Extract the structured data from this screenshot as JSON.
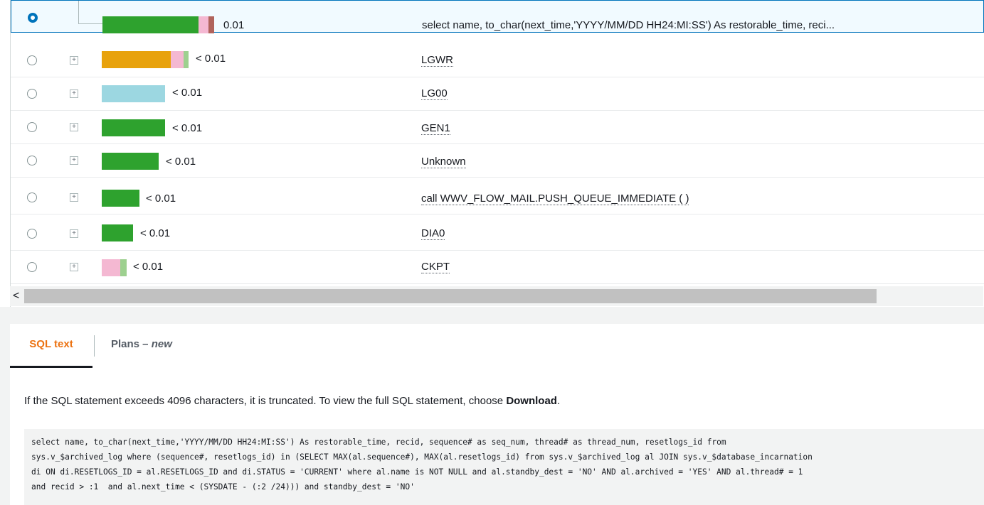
{
  "rows": [
    {
      "selected": true,
      "value": "0.01",
      "name": "select name, to_char(next_time,'YYYY/MM/DD HH24:MI:SS') As restorable_time, reci...",
      "expander": false
    },
    {
      "selected": false,
      "value": "< 0.01",
      "name": "LGWR",
      "expander": true
    },
    {
      "selected": false,
      "value": "< 0.01",
      "name": "LG00",
      "expander": true
    },
    {
      "selected": false,
      "value": "< 0.01",
      "name": "GEN1",
      "expander": true
    },
    {
      "selected": false,
      "value": "< 0.01",
      "name": "Unknown",
      "expander": true
    },
    {
      "selected": false,
      "value": "< 0.01",
      "name": "call WWV_FLOW_MAIL.PUSH_QUEUE_IMMEDIATE ( )",
      "expander": true
    },
    {
      "selected": false,
      "value": "< 0.01",
      "name": "DIA0",
      "expander": true
    },
    {
      "selected": false,
      "value": "< 0.01",
      "name": "CKPT",
      "expander": true
    }
  ],
  "colors": {
    "green": "#2ea22e",
    "orange": "#e8a20c",
    "pink": "#f4b8d2",
    "lightgreen": "#9dd08f",
    "lightblue": "#9cd7e1",
    "brownred": "#b0635c"
  },
  "scrollbar": {
    "left_arrow": "<"
  },
  "tabs": {
    "sql_text": "SQL text",
    "plans": "Plans – ",
    "plans_badge": "new"
  },
  "notice": {
    "text_before": "If the SQL statement exceeds 4096 characters, it is truncated. To view the full SQL statement, choose ",
    "download": "Download",
    "text_after": "."
  },
  "sql_text": "select name, to_char(next_time,'YYYY/MM/DD HH24:MI:SS') As restorable_time, recid, sequence# as seq_num, thread# as thread_num, resetlogs_id from\nsys.v_$archived_log where (sequence#, resetlogs_id) in (SELECT MAX(al.sequence#), MAX(al.resetlogs_id) from sys.v_$archived_log al JOIN sys.v_$database_incarnation\ndi ON di.RESETLOGS_ID = al.RESETLOGS_ID and di.STATUS = 'CURRENT' where al.name is NOT NULL and al.standby_dest = 'NO' AND al.archived = 'YES' AND al.thread# = 1\nand recid > :1  and al.next_time < (SYSDATE - (:2 /24))) and standby_dest = 'NO'"
}
